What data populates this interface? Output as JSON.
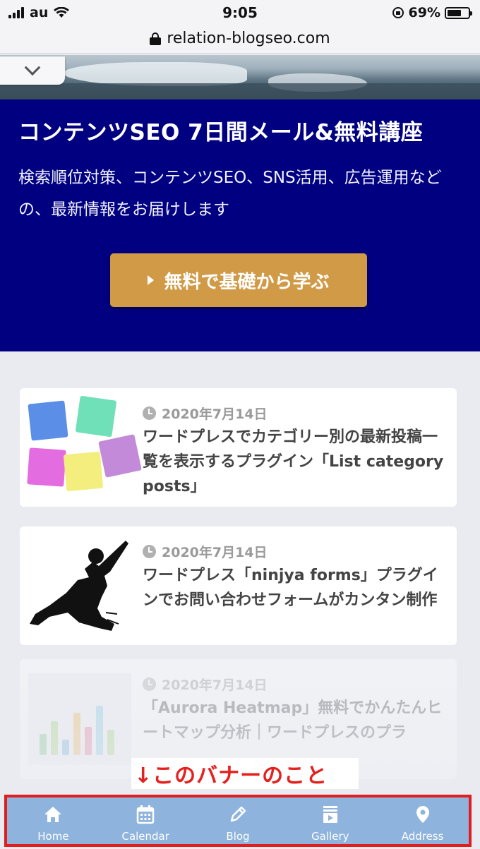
{
  "status_bar": {
    "carrier": "au",
    "time": "9:05",
    "battery": "69%",
    "battery_level": 0.69
  },
  "browser": {
    "url": "relation-blogseo.com"
  },
  "promo": {
    "title": "コンテンツSEO 7日間メール&無料講座",
    "description": "検索順位対策、コンテンツSEO、SNS活用、広告運用などの、最新情報をお届けします",
    "cta_label": "無料で基礎から学ぶ"
  },
  "posts": [
    {
      "date": "2020年7月14日",
      "title": "ワードプレスでカテゴリー別の最新投稿一覧を表示するプラグイン「List category posts」"
    },
    {
      "date": "2020年7月14日",
      "title": "ワードプレス「ninjya forms」プラグインでお問い合わせフォームがカンタン制作"
    },
    {
      "date": "2020年7月14日",
      "title": "「Aurora Heatmap」無料でかんたんヒートマップ分析｜ワードプレスのプラ"
    }
  ],
  "annotation": {
    "text": "↓このバナーのこと"
  },
  "bottom_nav": {
    "items": [
      {
        "label": "Home",
        "icon": "home-icon"
      },
      {
        "label": "Calendar",
        "icon": "calendar-icon"
      },
      {
        "label": "Blog",
        "icon": "pencil-icon"
      },
      {
        "label": "Gallery",
        "icon": "gallery-icon"
      },
      {
        "label": "Address",
        "icon": "location-pin-icon"
      }
    ]
  },
  "colors": {
    "promo_bg": "#000080",
    "cta_bg": "#d09a47",
    "nav_bg": "#8eb3dd",
    "highlight_border": "#e11d1d",
    "annotation_text": "#e6201d"
  }
}
